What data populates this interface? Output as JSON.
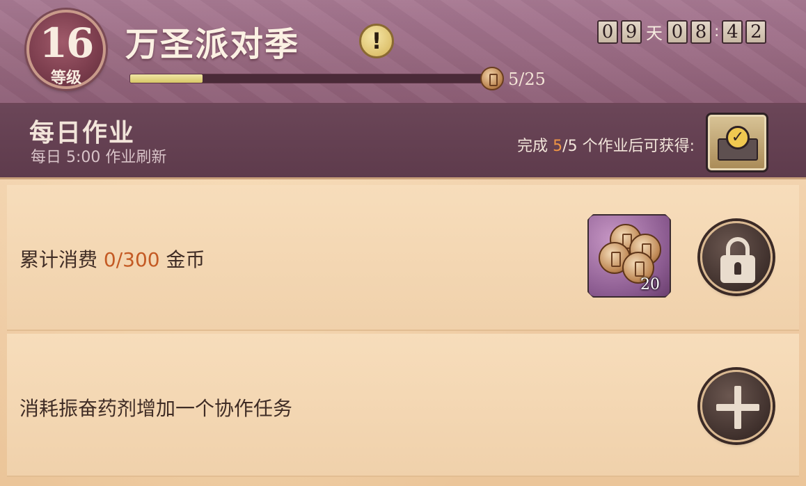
{
  "header": {
    "level": "16",
    "level_label": "等级",
    "event_title": "万圣派对季",
    "info_icon": "!",
    "progress": {
      "current": 5,
      "total": 25,
      "text": "5/25",
      "fraction": 0.2
    },
    "timer": {
      "days": [
        "0",
        "9"
      ],
      "day_unit": "天",
      "hours": [
        "0",
        "8"
      ],
      "separator": ":",
      "minutes": [
        "4",
        "2"
      ]
    }
  },
  "daily": {
    "title": "每日作业",
    "subtitle": "每日 5:00 作业刷新",
    "reward_prefix": "完成 ",
    "reward_done": "5",
    "reward_mid": "/5 个作业后可获得:",
    "reward_icon": "check-book-icon"
  },
  "tasks": [
    {
      "label_prefix": "累计消费 ",
      "current": "0",
      "label_mid": "/300",
      "label_suffix": " 金币",
      "reward_qty": "20",
      "reward_icon": "coin-stack-icon",
      "action_icon": "lock-icon"
    },
    {
      "label": "消耗振奋药剂增加一个协作任务",
      "action_icon": "plus-icon"
    }
  ],
  "colors": {
    "accent_orange": "#ef9545",
    "progress_fill": "#d8c767",
    "header_bg": "#97687f",
    "daily_bg": "#5e3b4c",
    "task_bg": "#f0d1ab"
  }
}
